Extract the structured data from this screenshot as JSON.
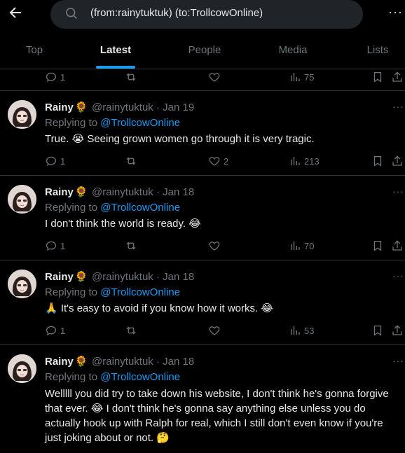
{
  "search": {
    "query": "(from:rainytuktuk) (to:TrollcowOnline)"
  },
  "tabs": [
    {
      "label": "Top"
    },
    {
      "label": "Latest"
    },
    {
      "label": "People"
    },
    {
      "label": "Media"
    },
    {
      "label": "Lists"
    }
  ],
  "partial_tweet": {
    "replies": "1",
    "likes": "",
    "views": "75"
  },
  "tweets": [
    {
      "name": "Rainy",
      "name_emoji": "🌻",
      "handle": "@rainytuktuk",
      "date": "Jan 19",
      "replying_prefix": "Replying to",
      "replying_to": "@TrollcowOnline",
      "text": "True. 😭 Seeing grown women go through it is very tragic.",
      "replies": "1",
      "likes": "2",
      "views": "213"
    },
    {
      "name": "Rainy",
      "name_emoji": "🌻",
      "handle": "@rainytuktuk",
      "date": "Jan 18",
      "replying_prefix": "Replying to",
      "replying_to": "@TrollcowOnline",
      "text": "I don't think the world is ready. 😂",
      "replies": "1",
      "likes": "",
      "views": "70"
    },
    {
      "name": "Rainy",
      "name_emoji": "🌻",
      "handle": "@rainytuktuk",
      "date": "Jan 18",
      "replying_prefix": "Replying to",
      "replying_to": "@TrollcowOnline",
      "text": "🙏 It's easy to avoid if you know how it works. 😂",
      "replies": "1",
      "likes": "",
      "views": "53"
    },
    {
      "name": "Rainy",
      "name_emoji": "🌻",
      "handle": "@rainytuktuk",
      "date": "Jan 18",
      "replying_prefix": "Replying to",
      "replying_to": "@TrollcowOnline",
      "text": "Welllll you did try to take down his website, I don't think he's gonna forgive that ever. 😂 I don't think he's gonna say anything else unless you do actually hook up with Ralph for real, which I still don't even know if you're just joking about or not. 🤔",
      "replies": "",
      "likes": "",
      "views": ""
    }
  ],
  "colors": {
    "background": "#000000",
    "text": "#e7e9ea",
    "secondary": "#71767b",
    "accent": "#1d9bf0",
    "divider": "#2f3336"
  }
}
